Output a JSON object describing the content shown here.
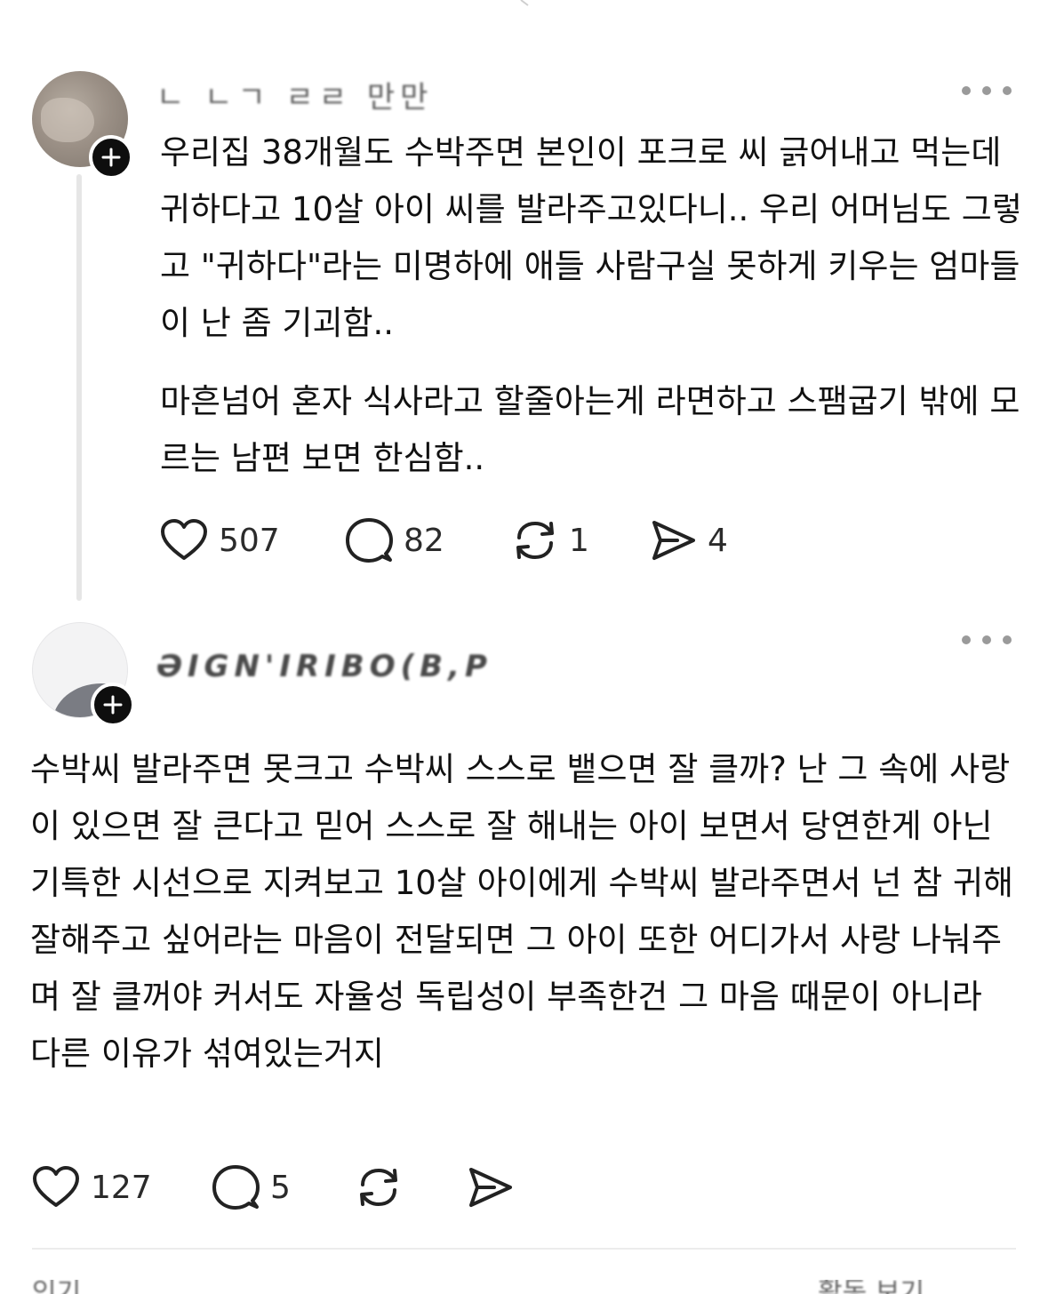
{
  "post1": {
    "username": "ㄴ ㄴㄱ ㄹㄹ 만만",
    "paragraph1": "우리집 38개월도 수박주면 본인이 포크로 씨 긁어내고 먹는데 귀하다고 10살 아이 씨를 발라주고있다니.. 우리 어머님도 그렇고 \"귀하다\"라는 미명하에 애들 사람구실 못하게 키우는 엄마들이 난 좀 기괴함..",
    "paragraph2": "마흔넘어 혼자 식사라고 할줄아는게 라면하고 스팸굽기 밖에 모르는 남편 보면 한심함..",
    "likes": "507",
    "comments": "82",
    "reposts": "1",
    "shares": "4"
  },
  "post2": {
    "username": "ƏIGN'IRIBO(B,P",
    "text": "수박씨 발라주면 못크고 수박씨 스스로 뱉으면 잘 클까? 난 그 속에 사랑이 있으면 잘 큰다고 믿어 스스로 잘 해내는 아이 보면서 당연한게 아닌 기특한 시선으로 지켜보고 10살 아이에게 수박씨 발라주면서 넌 참 귀해 잘해주고 싶어라는 마음이 전달되면 그 아이 또한 어디가서 사랑 나눠주며 잘 클꺼야 커서도 자율성 독립성이 부족한건 그  마음 때문이 아니라 다른 이유가 섞여있는거지",
    "likes": "127",
    "comments": "5"
  },
  "footer": {
    "left_fragment": "인기",
    "right_fragment": "활동 보기"
  },
  "icons": {
    "like": "heart-icon",
    "comment": "comment-bubble-icon",
    "repost": "repost-icon",
    "share": "send-icon",
    "more": "more-dots-icon",
    "follow": "plus-icon"
  }
}
